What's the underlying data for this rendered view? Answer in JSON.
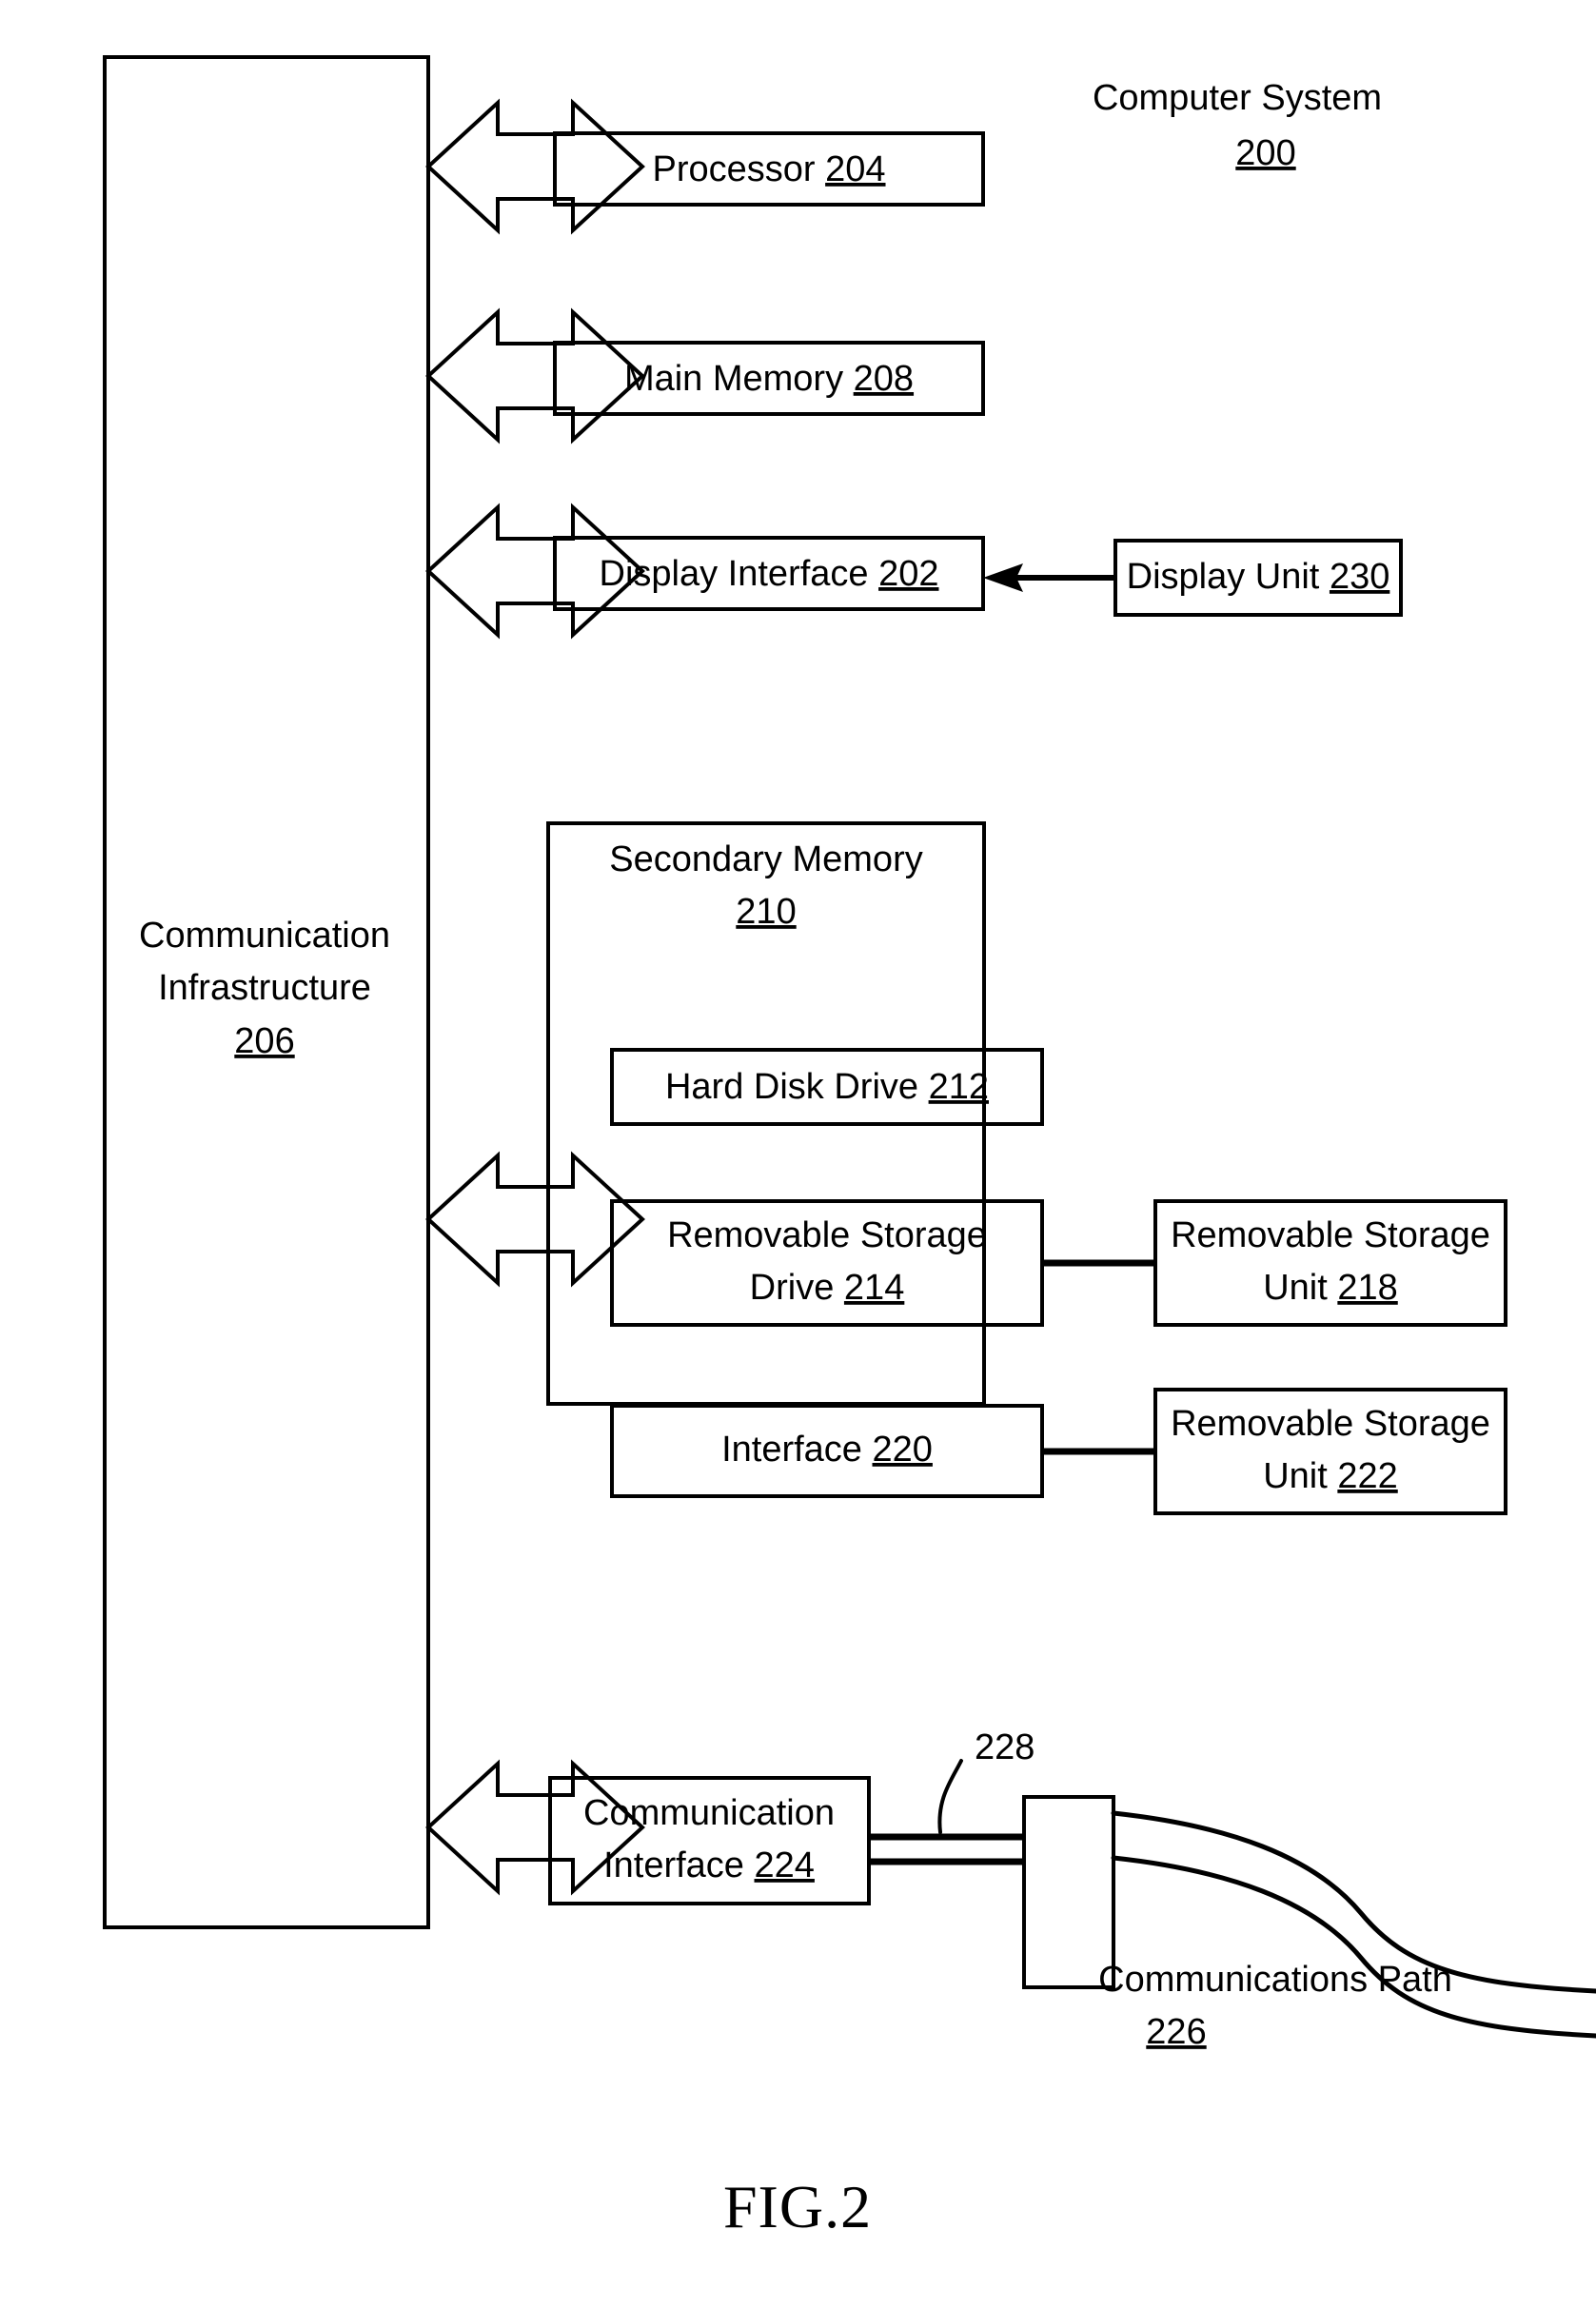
{
  "figure": {
    "caption": "FIG.2",
    "title_label": "Computer System",
    "title_ref": "200"
  },
  "bus": {
    "line1": "Communication",
    "line2": "Infrastructure",
    "ref": "206"
  },
  "blocks": {
    "processor": {
      "label": "Processor",
      "ref": "204"
    },
    "main_memory": {
      "label": "Main Memory",
      "ref": "208"
    },
    "display_interface": {
      "label": "Display Interface",
      "ref": "202"
    },
    "display_unit": {
      "label": "Display Unit",
      "ref": "230"
    },
    "secondary_memory": {
      "label": "Secondary Memory",
      "ref": "210"
    },
    "hard_disk_drive": {
      "label": "Hard Disk Drive",
      "ref": "212"
    },
    "removable_storage_drive": {
      "line1": "Removable Storage",
      "line2": "Drive",
      "ref": "214"
    },
    "removable_storage_unit_218": {
      "line1": "Removable Storage",
      "line2": "Unit",
      "ref": "218"
    },
    "interface_220": {
      "label": "Interface",
      "ref": "220"
    },
    "removable_storage_unit_222": {
      "line1": "Removable Storage",
      "line2": "Unit",
      "ref": "222"
    },
    "communication_interface": {
      "line1": "Communication",
      "line2": "Interface",
      "ref": "224"
    }
  },
  "annotations": {
    "connector_ref": "228",
    "comm_path_label": "Communications Path",
    "comm_path_ref": "226"
  },
  "colors": {
    "ink": "#000000",
    "paper": "#ffffff"
  }
}
